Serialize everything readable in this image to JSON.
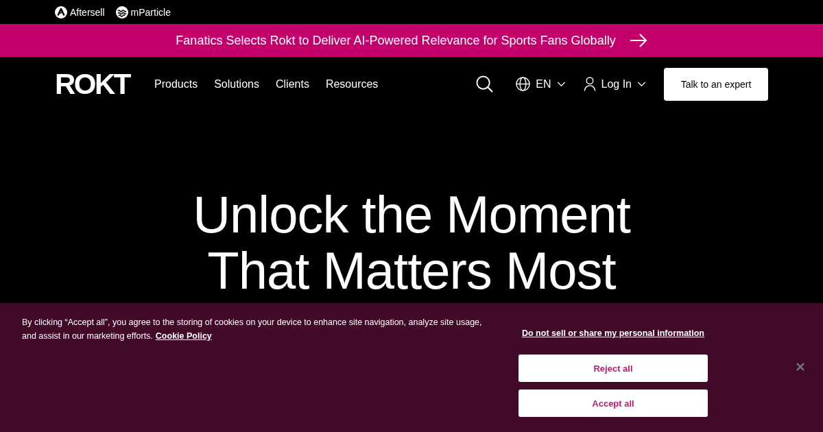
{
  "top_bar": {
    "brands": [
      {
        "label": "Aftersell",
        "kind": "badge"
      },
      {
        "label": "mParticle",
        "kind": "wave"
      }
    ]
  },
  "announcement": {
    "text": "Fanatics Selects Rokt to Deliver AI-Powered Relevance for Sports Fans Globally"
  },
  "nav": {
    "logo": "ROKT",
    "links": [
      "Products",
      "Solutions",
      "Clients",
      "Resources"
    ],
    "language": "EN",
    "login": "Log In",
    "cta": "Talk to an expert"
  },
  "hero": {
    "headline": "Unlock the Moment That Matters Most"
  },
  "cookie_banner": {
    "text": "By clicking “Accept all”, you agree to the storing of cookies on your device to enhance site navigation, analyze site usage, and assist in our marketing efforts.",
    "policy_link": "Cookie Policy",
    "privacy_link": "Do not sell or share my personal information",
    "buttons": [
      "Reject all",
      "Accept all"
    ]
  }
}
